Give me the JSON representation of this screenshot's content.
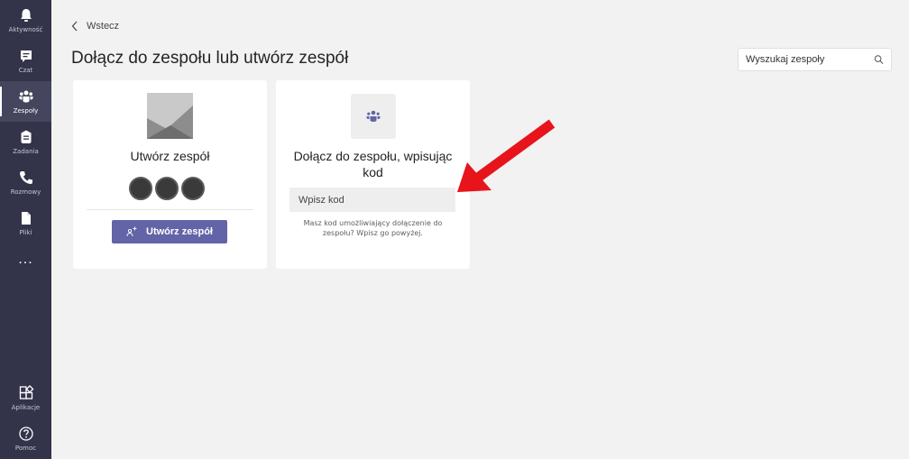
{
  "sidebar": {
    "items": [
      {
        "label": "Aktywność",
        "icon": "bell-icon"
      },
      {
        "label": "Czat",
        "icon": "chat-icon"
      },
      {
        "label": "Zespoły",
        "icon": "teams-icon",
        "active": true
      },
      {
        "label": "Zadania",
        "icon": "assignments-icon"
      },
      {
        "label": "Rozmowy",
        "icon": "phone-icon"
      },
      {
        "label": "Pliki",
        "icon": "files-icon"
      }
    ],
    "more": "...",
    "bottom": [
      {
        "label": "Aplikacje",
        "icon": "apps-icon"
      },
      {
        "label": "Pomoc",
        "icon": "help-icon"
      }
    ]
  },
  "header": {
    "back_label": "Wstecz",
    "title": "Dołącz do zespołu lub utwórz zespół",
    "search_placeholder": "Wyszukaj zespoły"
  },
  "create_card": {
    "heading": "Utwórz zespół",
    "button_label": "Utwórz zespół"
  },
  "join_card": {
    "heading": "Dołącz do zespołu, wpisując kod",
    "input_placeholder": "Wpisz kod",
    "hint": "Masz kod umożliwiający dołączenie do zespołu? Wpisz go powyżej."
  },
  "colors": {
    "rail": "#33344a",
    "accent": "#6264a7",
    "annotation_arrow": "#e8141b"
  }
}
